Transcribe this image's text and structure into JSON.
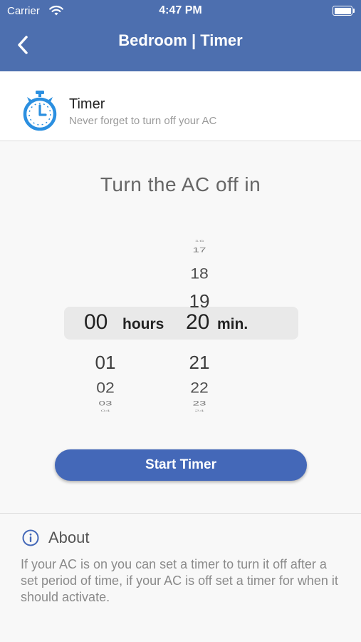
{
  "status_bar": {
    "carrier": "Carrier",
    "time": "4:47 PM",
    "icons": [
      "wifi-icon",
      "battery-icon"
    ]
  },
  "nav": {
    "back_icon": "chevron-left-icon",
    "title": "Bedroom | Timer"
  },
  "timer_section": {
    "icon": "stopwatch-icon",
    "title": "Timer",
    "subtitle": "Never forget to turn off your AC"
  },
  "prompt": "Turn the AC off in",
  "picker": {
    "hours": {
      "above": [],
      "selected": "00",
      "label": "hours",
      "below": [
        "01",
        "02",
        "03",
        "04"
      ]
    },
    "minutes": {
      "above": [
        "16",
        "17",
        "18",
        "19"
      ],
      "selected": "20",
      "label": "min.",
      "below": [
        "21",
        "22",
        "23",
        "24"
      ]
    }
  },
  "start_button": {
    "label": "Start Timer"
  },
  "about": {
    "icon": "info-icon",
    "title": "About",
    "text": "If your AC is on you can set a timer to turn it off after a set period of time, if your AC is off set a timer for when it should activate."
  },
  "colors": {
    "nav_bar": "#4d6faf",
    "accent": "#4468b8",
    "icon_blue": "#2b8fe0"
  }
}
